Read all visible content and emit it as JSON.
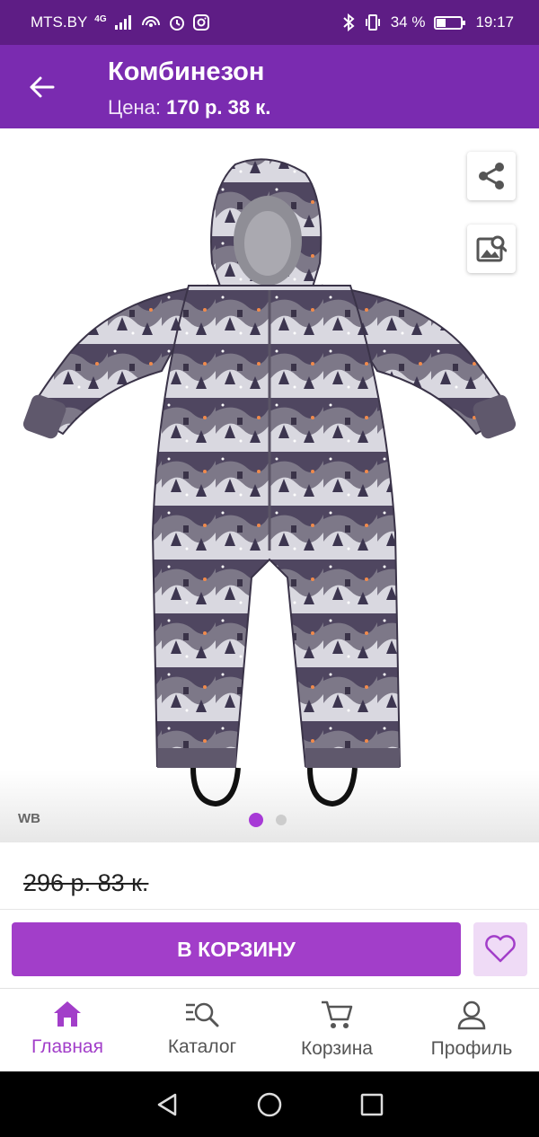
{
  "status_bar": {
    "carrier": "MTS.BY",
    "network": "4G",
    "battery_text": "34 %",
    "time": "19:17"
  },
  "app_bar": {
    "title": "Комбинезон",
    "price_label": "Цена:",
    "price_value": "170 р. 38 к.",
    "back_icon": "arrow-left-icon"
  },
  "gallery": {
    "brand_mark": "WB",
    "slides_total": 2,
    "active_slide": 1,
    "image_subject": "children's winter jumpsuit"
  },
  "old_price": "296 р. 83 к.",
  "actions": {
    "add_to_cart": "В КОРЗИНУ"
  },
  "bottom_nav": [
    {
      "label": "Главная",
      "icon": "home-icon",
      "active": true
    },
    {
      "label": "Каталог",
      "icon": "catalog-search-icon",
      "active": false
    },
    {
      "label": "Корзина",
      "icon": "cart-icon",
      "active": false
    },
    {
      "label": "Профиль",
      "icon": "profile-icon",
      "active": false
    }
  ],
  "colors": {
    "status_bar": "#5e1d85",
    "app_bar": "#7a2bb0",
    "accent": "#a23ec9",
    "fav_bg": "#efdbf6"
  }
}
